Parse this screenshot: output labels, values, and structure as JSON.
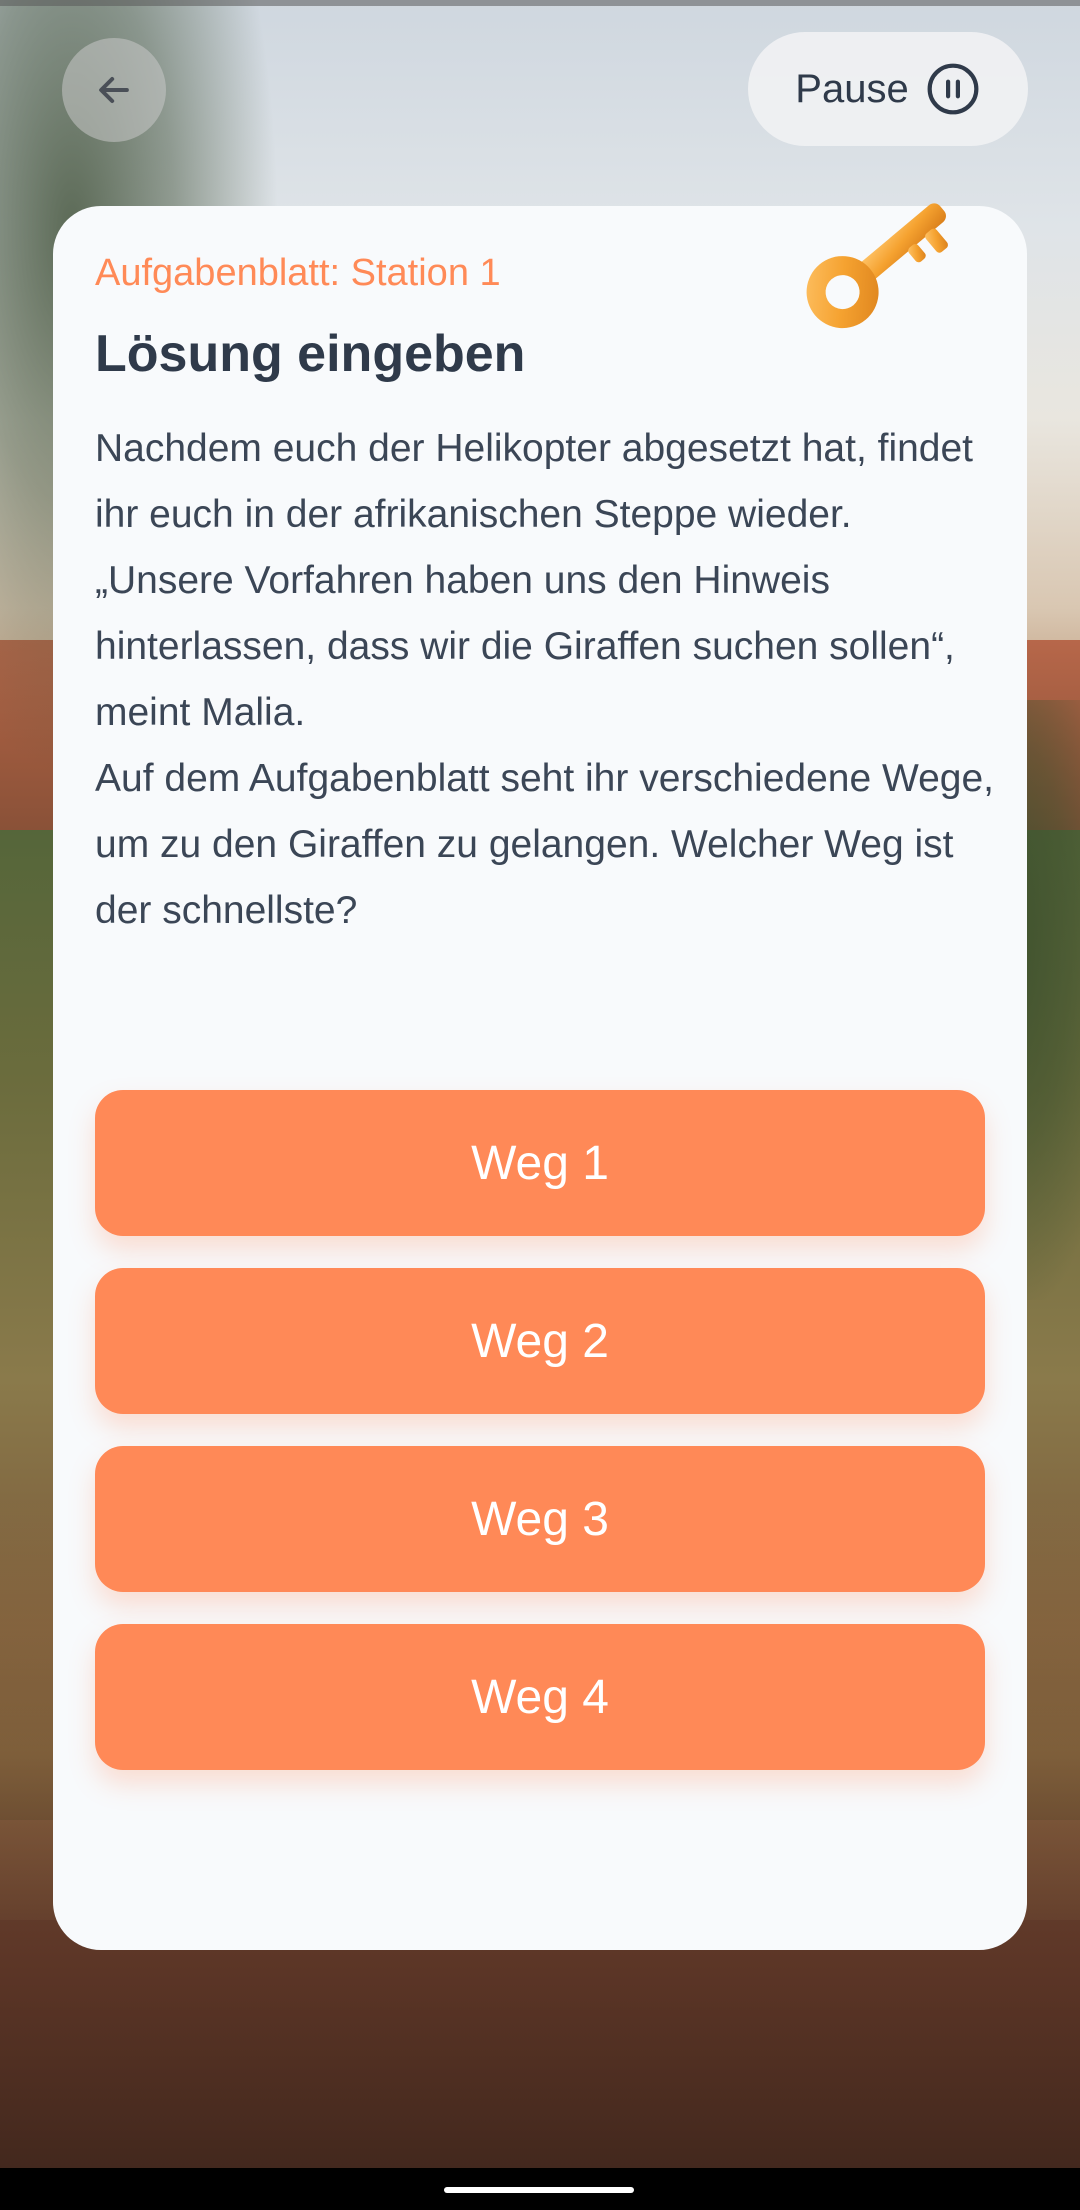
{
  "header": {
    "pause_label": "Pause"
  },
  "card": {
    "subtitle": "Aufgabenblatt: Station 1",
    "title": "Lösung eingeben",
    "paragraphs": [
      "Nachdem euch der Helikopter abgesetzt hat, findet ihr euch in der afrikanischen Steppe wieder.",
      "„Unsere Vorfahren haben uns den Hinweis hinterlassen, dass wir die Giraffen suchen sollen“, meint Malia.",
      "Auf dem Aufgabenblatt seht ihr verschiedene Wege, um zu den Giraffen zu gelangen. Welcher Weg ist der schnellste?"
    ],
    "answers": [
      {
        "label": "Weg 1"
      },
      {
        "label": "Weg 2"
      },
      {
        "label": "Weg 3"
      },
      {
        "label": "Weg 4"
      }
    ]
  },
  "icons": {
    "back": "arrow-left-icon",
    "pause": "pause-circle-icon",
    "key": "key-icon"
  },
  "colors": {
    "accent": "#ff8957",
    "subtitle": "#ff8a57",
    "text": "#2f3a4a",
    "card_bg": "#f8fafc"
  }
}
